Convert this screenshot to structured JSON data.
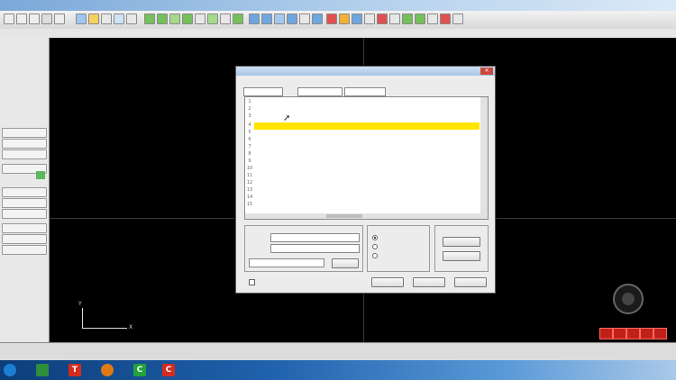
{
  "window": {
    "title": ""
  },
  "menu": [],
  "left_panel": {
    "items": [
      {
        "label": "",
        "kind": "text"
      },
      {
        "label": "",
        "kind": "text"
      },
      {
        "label": "",
        "kind": "text"
      },
      {
        "label": "",
        "kind": "text"
      },
      {
        "label": "",
        "kind": "text"
      },
      {
        "label": "",
        "kind": "text"
      },
      {
        "label": "",
        "kind": "text"
      },
      {
        "label": "",
        "kind": "text"
      },
      {
        "label": "",
        "kind": "text"
      }
    ]
  },
  "canvas": {
    "axis_y_label": "Y",
    "axis_x_label": "X"
  },
  "status": {
    "text": ""
  },
  "dialog": {
    "title": "",
    "toolbar": [
      "",
      "",
      ""
    ],
    "row_numbers": [
      "1",
      "2",
      "3",
      "4",
      "5",
      "6",
      "7",
      "8",
      "9",
      "10",
      "11",
      "12",
      "13",
      "14",
      "15"
    ],
    "highlight_row": 3,
    "group_left_label": "",
    "group_right_label": "",
    "group_far_right_label": "",
    "field_values": [
      "",
      "",
      ""
    ],
    "buttons": {
      "browse": "",
      "action1": "",
      "action2": "",
      "ok": "",
      "apply": "",
      "cancel": ""
    },
    "checkbox_label": ""
  },
  "taskbar": {
    "icons": [
      {
        "name": "start-icon",
        "color": "#1a7fd4",
        "glyph": ""
      },
      {
        "name": "explorer-icon",
        "color": "#2d8f3c",
        "glyph": ""
      },
      {
        "name": "app-t-icon",
        "color": "#d62b1f",
        "glyph": "T"
      },
      {
        "name": "app-flower-icon",
        "color": "#e07a14",
        "glyph": ""
      },
      {
        "name": "app-c-icon",
        "color": "#21a33a",
        "glyph": "C"
      },
      {
        "name": "app-c2-icon",
        "color": "#d62b1f",
        "glyph": "C"
      }
    ]
  },
  "colors": {
    "canvas": "#000000",
    "highlight": "#ffe400",
    "accent_red": "#c0201a"
  }
}
